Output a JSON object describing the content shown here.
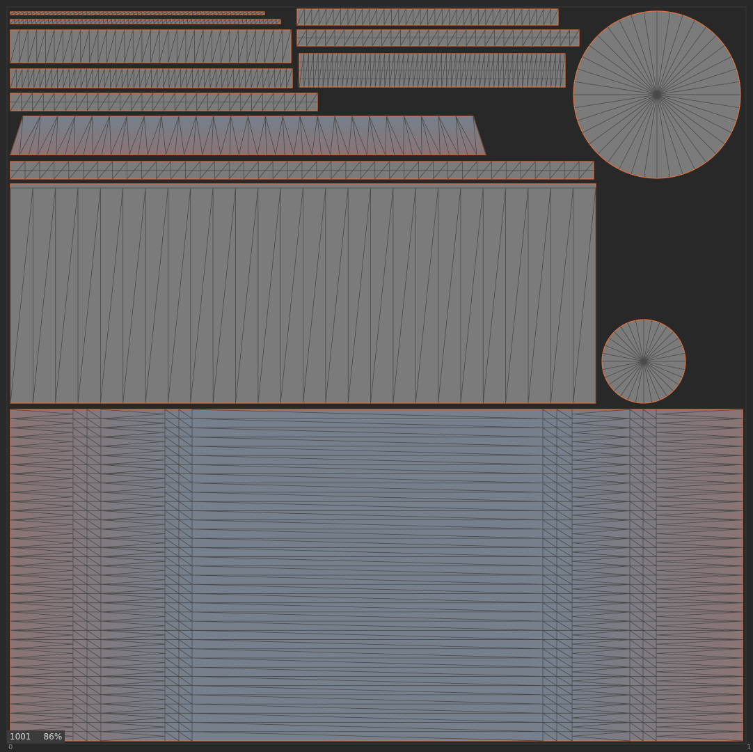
{
  "viewport": {
    "udim_tile": "1001",
    "zoom": "86%",
    "axis_origin_label": "0",
    "axis_end_label": "1"
  },
  "colors": {
    "background": "#282828",
    "island_fill": "#7b7b7b",
    "island_fill_blue": "#75808c",
    "island_fill_pink": "#8a7474",
    "wire": "#4a4a4a",
    "island_border": "#e0703c"
  }
}
